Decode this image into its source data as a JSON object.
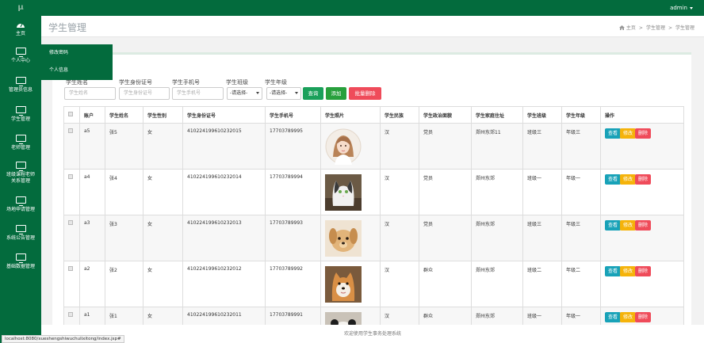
{
  "app": {
    "logo": "μ",
    "user": "admin"
  },
  "sidebar": {
    "items": [
      {
        "label": "主页",
        "icon": "dashboard-icon"
      },
      {
        "label": "个人中心",
        "icon": "monitor-icon"
      },
      {
        "label": "管理员信息",
        "icon": "monitor-icon"
      },
      {
        "label": "学生管理",
        "icon": "monitor-icon"
      },
      {
        "label": "老师管理",
        "icon": "monitor-icon"
      },
      {
        "label_line1": "班级课程老师",
        "label_line2": "关系管理",
        "icon": "monitor-icon"
      },
      {
        "label": "场地申请管理",
        "icon": "monitor-icon"
      },
      {
        "label": "系统公告管理",
        "icon": "monitor-icon"
      },
      {
        "label": "基础数据管理",
        "icon": "monitor-icon"
      }
    ],
    "submenu": [
      "修改密码",
      "个人信息"
    ]
  },
  "header": {
    "title": "学生管理",
    "breadcrumb": [
      "主页",
      "学生管理",
      "学生管理"
    ]
  },
  "search": {
    "name_label": "学生姓名",
    "name_placeholder": "学生姓名",
    "id_label": "学生身份证号",
    "id_placeholder": "学生身份证号",
    "phone_label": "学生手机号",
    "phone_placeholder": "学生手机号",
    "class_label": "学生班级",
    "class_value": "-请选择-",
    "grade_label": "学生年级",
    "grade_value": "-请选择-",
    "query_btn": "查询",
    "add_btn": "添加",
    "batch_delete_btn": "批量删除"
  },
  "table": {
    "columns": [
      "账户",
      "学生姓名",
      "学生性别",
      "学生身份证号",
      "学生手机号",
      "学生照片",
      "学生民族",
      "学生政治面貌",
      "学生家庭住址",
      "学生班级",
      "学生年级",
      "操作"
    ],
    "rows": [
      {
        "account": "a5",
        "name": "张5",
        "gender": "女",
        "id_no": "410224199610232015",
        "phone": "17703789995",
        "photo": "girl-portrait",
        "ethnic": "汉",
        "politics": "党员",
        "address": "郑州东郊11",
        "class": "班级三",
        "grade": "年级三"
      },
      {
        "account": "a4",
        "name": "张4",
        "gender": "女",
        "id_no": "410224199610232014",
        "phone": "17703789994",
        "photo": "cat-photo",
        "ethnic": "汉",
        "politics": "党员",
        "address": "郑州东郊",
        "class": "班级一",
        "grade": "年级一"
      },
      {
        "account": "a3",
        "name": "张3",
        "gender": "女",
        "id_no": "410224199610232013",
        "phone": "17703789993",
        "photo": "puppy-photo",
        "ethnic": "汉",
        "politics": "党员",
        "address": "郑州东郊",
        "class": "班级三",
        "grade": "年级三"
      },
      {
        "account": "a2",
        "name": "张2",
        "gender": "女",
        "id_no": "410224199610232012",
        "phone": "17703789992",
        "photo": "shiba-photo",
        "ethnic": "汉",
        "politics": "群众",
        "address": "郑州东郊",
        "class": "班级二",
        "grade": "年级二"
      },
      {
        "account": "a1",
        "name": "张1",
        "gender": "女",
        "id_no": "410224199610232011",
        "phone": "17703789991",
        "photo": "panda-dog-photo",
        "ethnic": "汉",
        "politics": "群众",
        "address": "郑州东郊",
        "class": "班级一",
        "grade": "年级一"
      }
    ],
    "actions": {
      "view": "查看",
      "edit": "修改",
      "delete": "删除"
    }
  },
  "footer": {
    "text": "欢迎使用学生事务处理系统"
  },
  "status_bar": {
    "url": "localhost:8080/xueshengshiwuchulixitong/index.jsp#"
  },
  "colors": {
    "brand": "#036b3d",
    "query": "#1aa05a",
    "add": "#28a03c",
    "delete": "#ef4b5a",
    "view": "#18a2b8",
    "edit": "#f5b30a"
  }
}
